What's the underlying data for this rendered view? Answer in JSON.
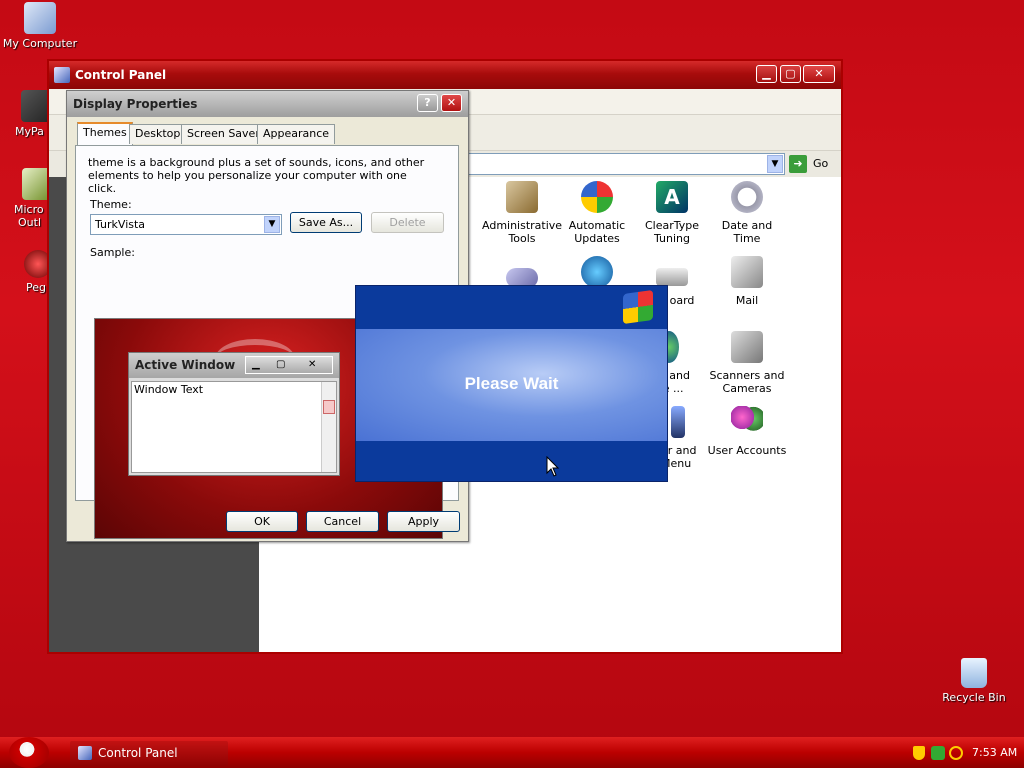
{
  "desktop": {
    "icons": [
      {
        "label": "My Computer"
      },
      {
        "label": "MyPa"
      },
      {
        "label": "Micro"
      },
      {
        "label": "Outl"
      },
      {
        "label": "Peg"
      },
      {
        "label": "Recycle Bin"
      }
    ]
  },
  "control_panel": {
    "title": "Control Panel",
    "go_label": "Go",
    "overflow_text": "...",
    "icons": [
      {
        "label": "Administrative Tools"
      },
      {
        "label": "Automatic Updates"
      },
      {
        "label": "ClearType Tuning"
      },
      {
        "label": "Date and Time"
      },
      {
        "label": "oard"
      },
      {
        "label": "Mail"
      },
      {
        "label": "nal and age ..."
      },
      {
        "label": "Scanners and Cameras"
      },
      {
        "label": "ar and Menu"
      },
      {
        "label": "User Accounts"
      }
    ]
  },
  "display_properties": {
    "title": "Display Properties",
    "tabs": [
      "Themes",
      "Desktop",
      "Screen Saver",
      "Appearance"
    ],
    "description": "theme is a background plus a set of sounds, icons, and other elements to help you personalize your computer with one click.",
    "theme_label": "Theme:",
    "theme_value": "TurkVista",
    "save_as": "Save As...",
    "delete": "Delete",
    "sample_label": "Sample:",
    "preview": {
      "active_window": "Active Window",
      "window_text": "Window Text"
    },
    "ok": "OK",
    "cancel": "Cancel",
    "apply": "Apply"
  },
  "please_wait": {
    "message": "Please Wait"
  },
  "taskbar": {
    "task_label": "Control Panel",
    "clock": "7:53 AM"
  },
  "colors": {
    "desktop": "#c40a14",
    "xp_blue": "#0b3a9c"
  }
}
